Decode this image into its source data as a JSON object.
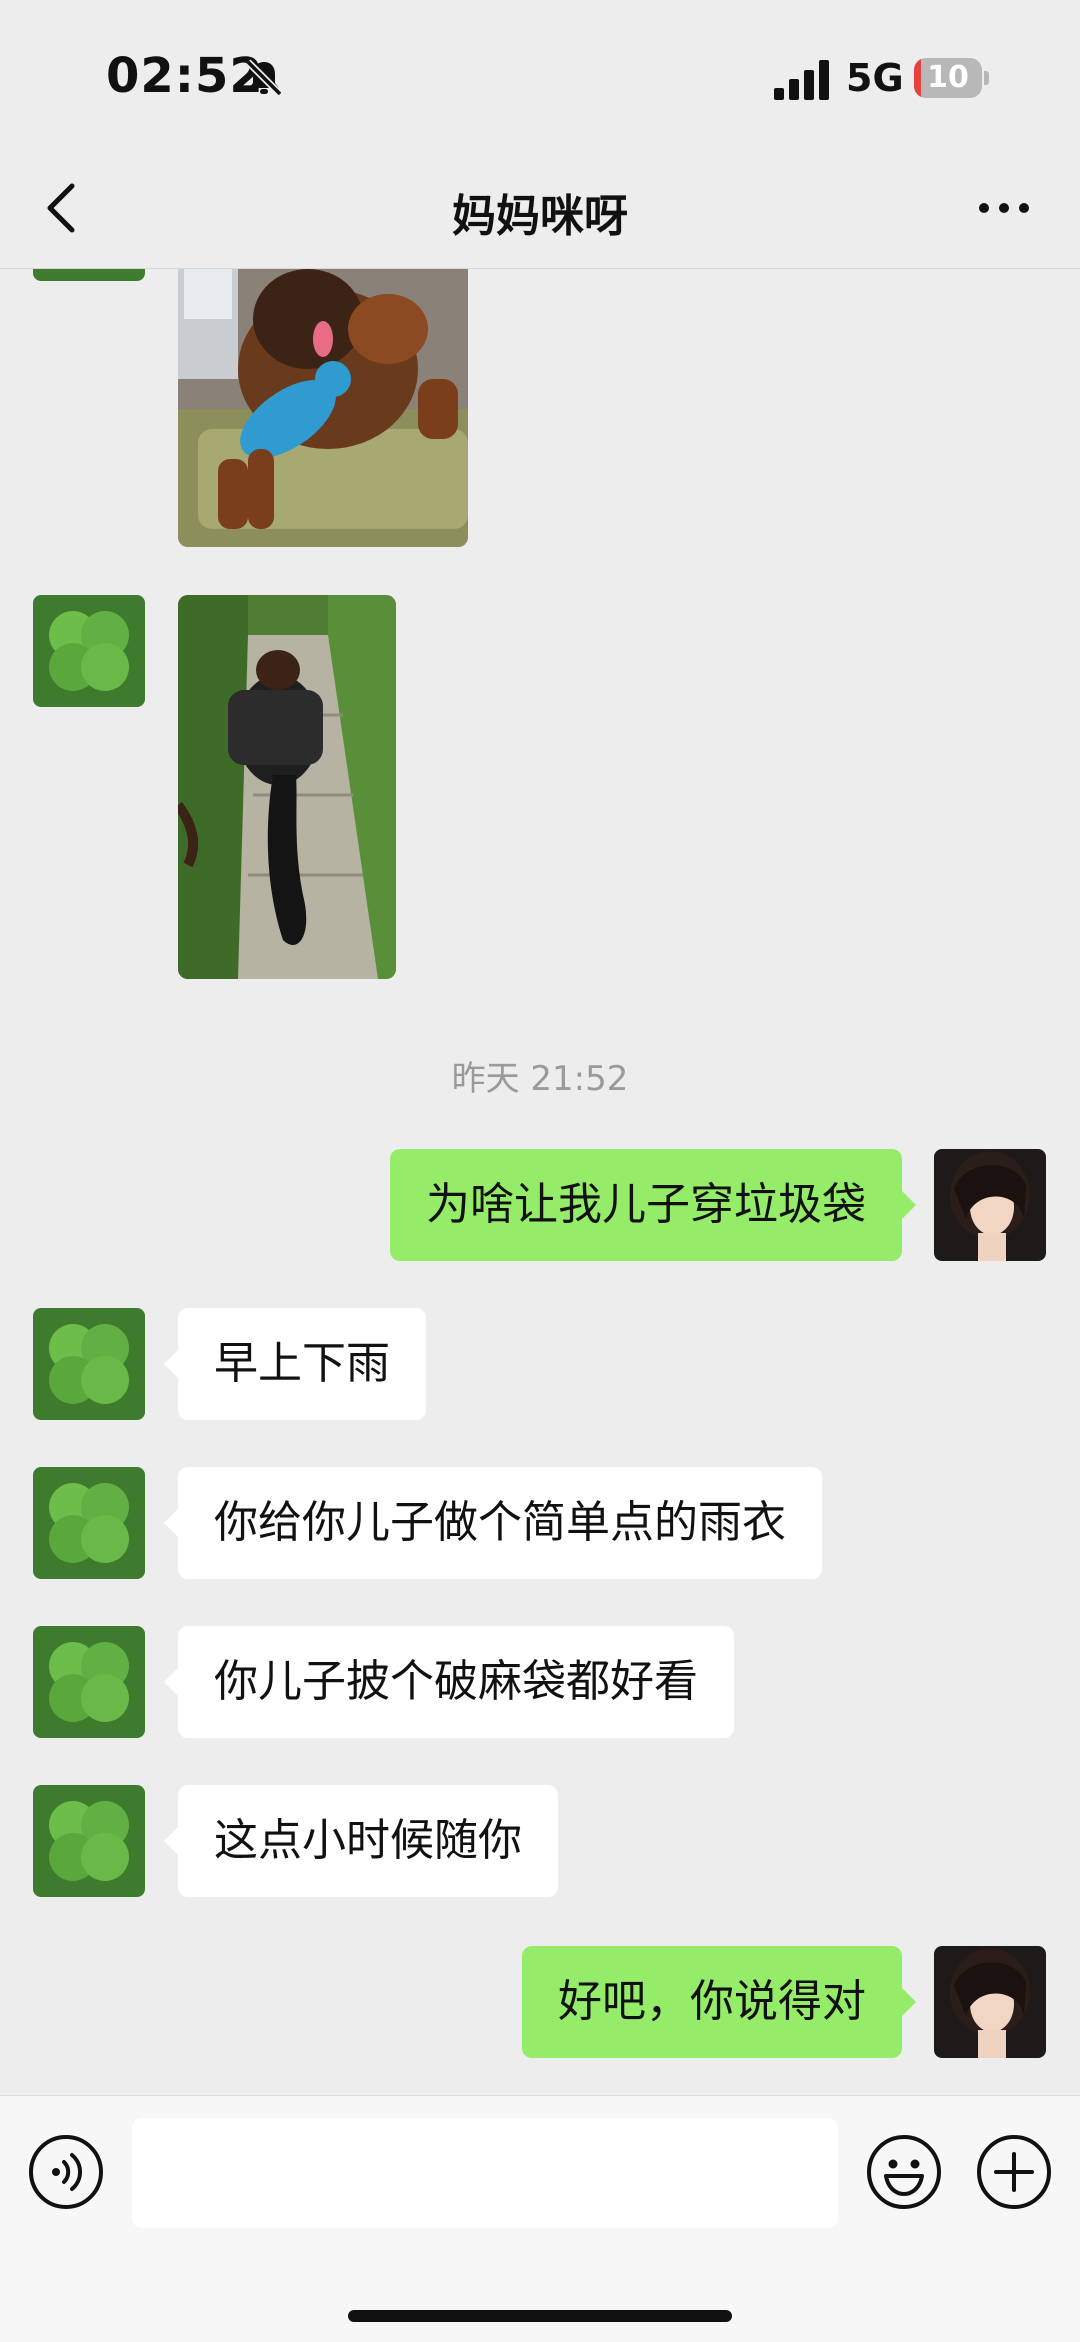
{
  "status_bar": {
    "time": "02:52",
    "network": "5G",
    "battery_level": "10",
    "battery_fraction": 0.1,
    "icons": [
      "bell-slash-icon",
      "signal-icon",
      "battery-icon"
    ]
  },
  "nav": {
    "title": "妈妈咪呀",
    "back_icon": "chevron-left-icon",
    "more_icon": "ellipsis-icon"
  },
  "chat": {
    "timestamp": "昨天 21:52",
    "messages": [
      {
        "from": "contact",
        "text": "早上下雨"
      },
      {
        "from": "contact",
        "text": "你给你儿子做个简单点的雨衣"
      },
      {
        "from": "contact",
        "text": "你儿子披个破麻袋都好看"
      },
      {
        "from": "contact",
        "text": "这点小时候随你"
      }
    ],
    "my_messages": [
      {
        "from": "me",
        "text": "为啥让我儿子穿垃圾袋"
      },
      {
        "from": "me",
        "text": "好吧，你说得对"
      }
    ]
  },
  "input_bar": {
    "icons": [
      "voice-icon",
      "emoji-icon",
      "plus-icon"
    ],
    "text_value": ""
  },
  "colors": {
    "background": "#ededed",
    "outgoing_bubble": "#95ec69",
    "incoming_bubble": "#ffffff",
    "timestamp": "#9a9a9a",
    "battery_low": "#e5413d"
  }
}
